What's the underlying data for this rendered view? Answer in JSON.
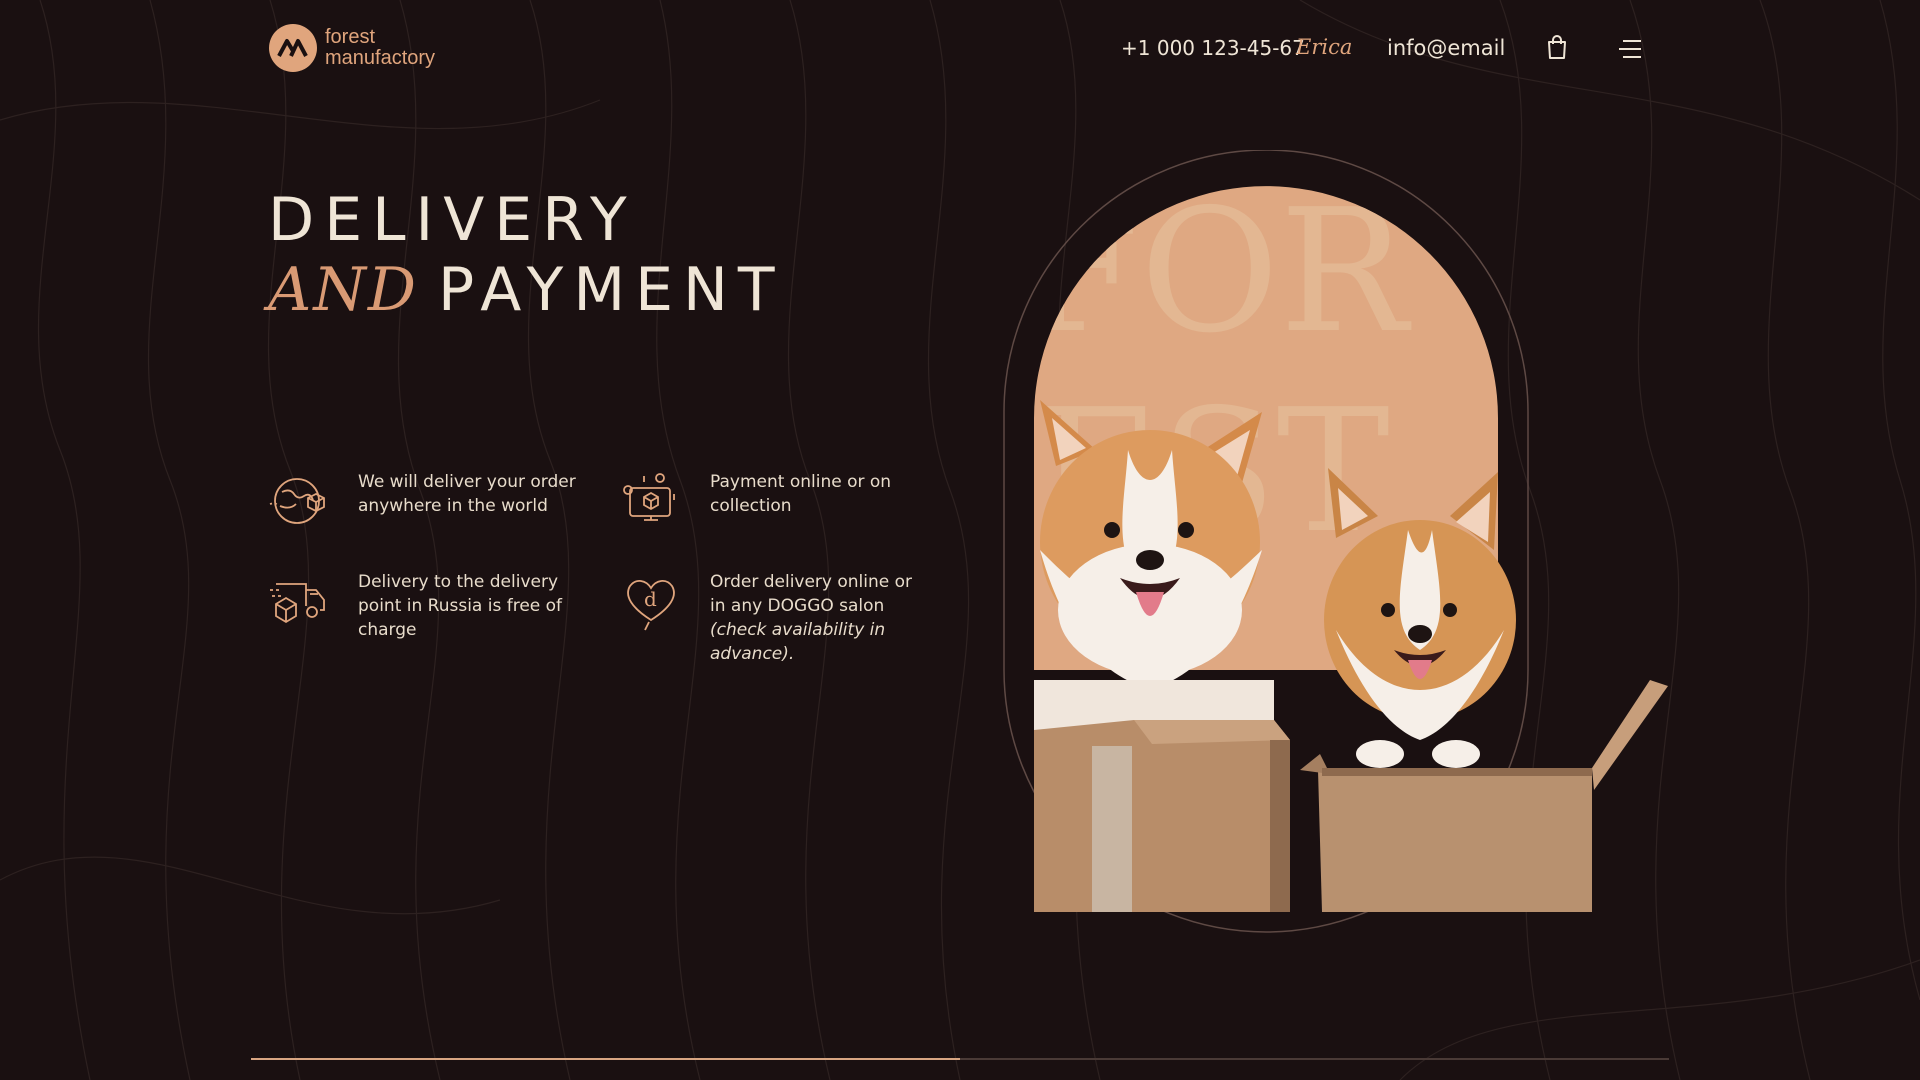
{
  "header": {
    "logo": {
      "line1": "forest",
      "line2": "manufactory"
    },
    "phone": "+1 000 123-45-67",
    "name": "Erica",
    "email": "info@email",
    "cart_icon": "shopping-bag-icon",
    "menu_icon": "hamburger-menu-icon"
  },
  "title": {
    "line1": "DELIVERY",
    "line2_italic": "AND",
    "line2_plain": "PAYMENT"
  },
  "features": [
    {
      "icon": "globe-delivery-icon",
      "text": "We will deliver your order anywhere in the world"
    },
    {
      "icon": "online-payment-icon",
      "text": "Payment online or on collection"
    },
    {
      "icon": "delivery-truck-icon",
      "text": "Delivery to the delivery point in Russia is free of charge"
    },
    {
      "icon": "heart-logo-icon",
      "text": "Order delivery online or in any DOGGO salon",
      "text_italic": "(check availability in advance)."
    }
  ],
  "hero": {
    "background_text_1": "FOR",
    "background_text_2": "EST",
    "image": "two-corgi-puppies-in-boxes"
  },
  "progress": {
    "value": 0.5
  },
  "colors": {
    "background": "#1a1011",
    "accent": "#e0a57d",
    "text": "#efe5d6",
    "hero_bg": "#dfa882"
  }
}
